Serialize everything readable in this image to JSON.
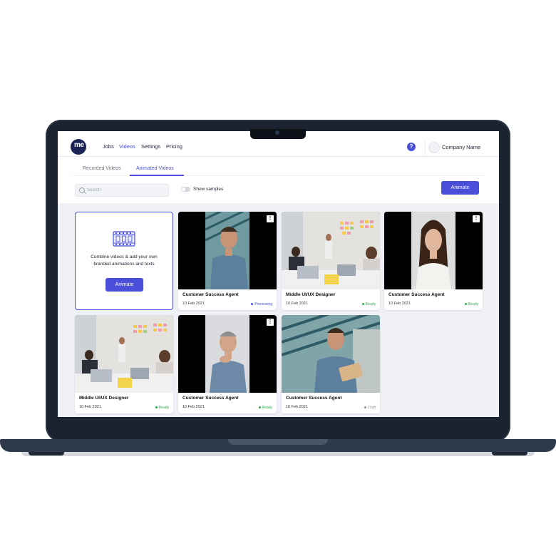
{
  "nav": {
    "logo_text": "me",
    "links": [
      "Jobs",
      "Videos",
      "Settings",
      "Pricing"
    ],
    "active_link": "Videos",
    "help_label": "?",
    "company_name": "Company Name"
  },
  "tabs": [
    {
      "label": "Recorded Videos",
      "active": false
    },
    {
      "label": "Animated Videos",
      "active": true
    }
  ],
  "toolbar": {
    "search_placeholder": "Search",
    "toggle_label": "Show samples",
    "toggle_on": false,
    "animate_label": "Animate"
  },
  "create_card": {
    "text": "Combine videos & add your own branded animations and texts",
    "button_label": "Animate"
  },
  "videos": [
    {
      "title": "Customer Success Agent",
      "date": "10 Feb 2021",
      "status": "Processing"
    },
    {
      "title": "Middle UI/UX Designer",
      "date": "10 Feb 2021",
      "status": "Ready"
    },
    {
      "title": "Customer Success Agent",
      "date": "10 Feb 2021",
      "status": "Ready"
    },
    {
      "title": "Middle UI/UX Designer",
      "date": "10 Feb 2021",
      "status": "Ready"
    },
    {
      "title": "Customer Success Agent",
      "date": "10 Feb 2021",
      "status": "Ready"
    },
    {
      "title": "Customer Success Agent",
      "date": "10 Feb 2021",
      "status": "Draft"
    }
  ],
  "colors": {
    "accent": "#4a4fd9",
    "processing": "#4a4fd9",
    "ready": "#2fa84f",
    "draft": "#8a8f9c",
    "laptop": "#1b2330"
  }
}
